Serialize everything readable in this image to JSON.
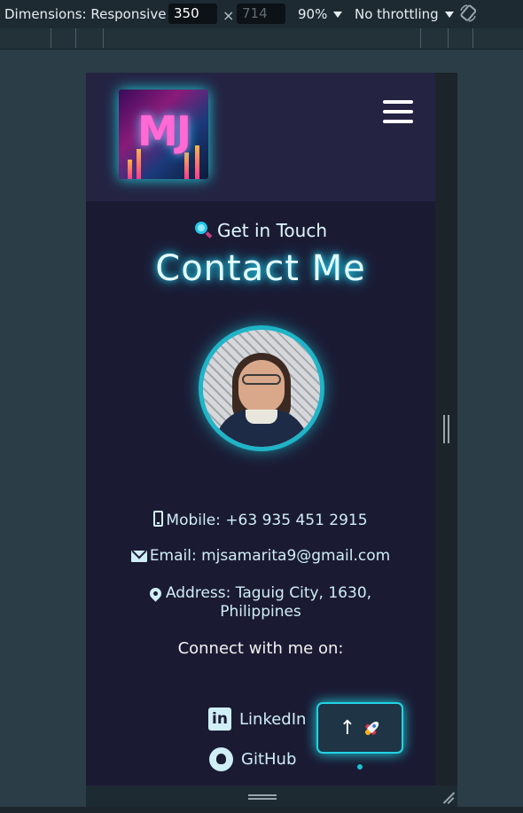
{
  "devtools": {
    "dimensions_label": "Dimensions: Responsive",
    "width_value": "350",
    "height_placeholder": "714",
    "times": "×",
    "zoom": "90%",
    "throttling": "No throttling",
    "rotate_icon": "rotate-icon"
  },
  "site": {
    "logo_text": "MJ",
    "menu_icon": "hamburger-icon",
    "subtitle": "Get in Touch",
    "subtitle_icon": "magnifier-icon",
    "title": "Contact Me",
    "contacts": {
      "mobile": "Mobile: +63 935 451 2915",
      "email": "Email: mjsamarita9@gmail.com",
      "address_line1": "Address: Taguig City, 1630,",
      "address_line2": "Philippines"
    },
    "connect_label": "Connect with me on:",
    "social": {
      "linkedin": "LinkedIn",
      "linkedin_icon_text": "in",
      "github": "GitHub"
    },
    "back_to_top_arrow": "↑"
  },
  "colors": {
    "accent": "#22d3e4",
    "page_bg": "#1b1a33",
    "header_bg": "#242342",
    "devtools_bg": "#1e2a32"
  }
}
